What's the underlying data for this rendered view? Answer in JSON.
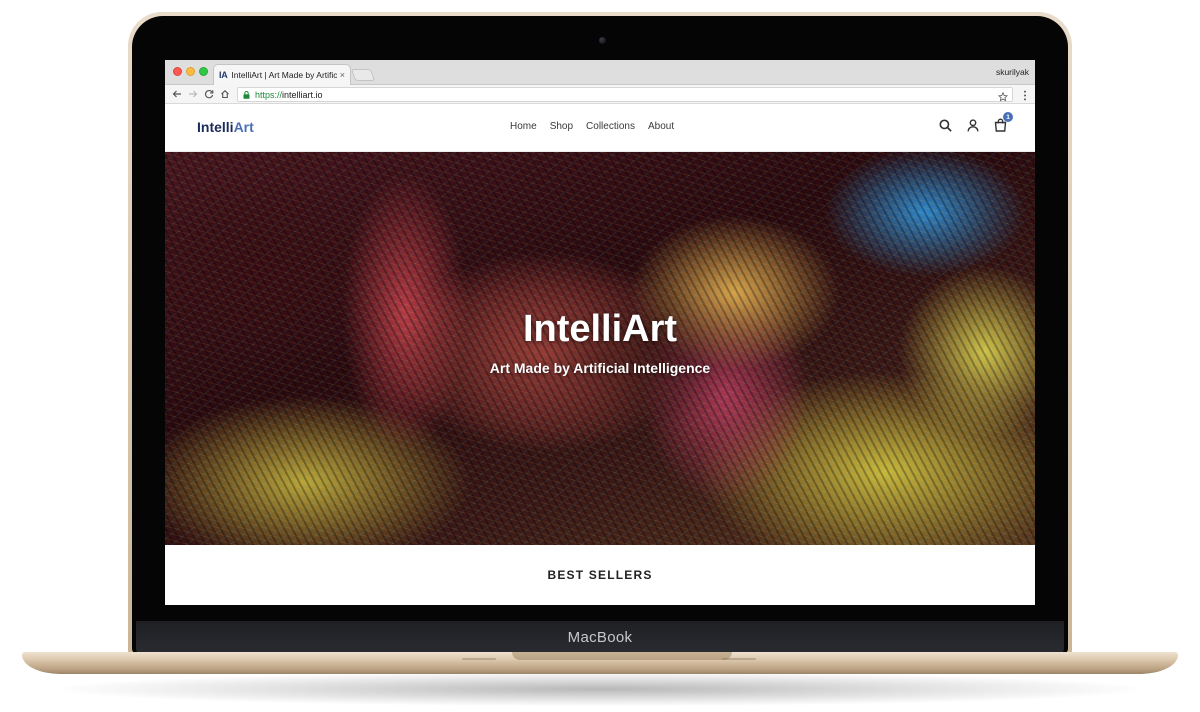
{
  "device": {
    "brand_label": "MacBook"
  },
  "browser": {
    "tab": {
      "favicon_text": "IA",
      "title": "IntelliArt | Art Made by Artificial Intelligence",
      "close_label": "×"
    },
    "profile_name": "skurilyak",
    "address": {
      "protocol": "https://",
      "host": "intelliart.io"
    }
  },
  "site": {
    "logo": {
      "part1": "Intelli",
      "part2": "Art"
    },
    "nav": [
      {
        "label": "Home"
      },
      {
        "label": "Shop"
      },
      {
        "label": "Collections"
      },
      {
        "label": "About"
      }
    ],
    "header_icons": [
      "search-icon",
      "account-icon",
      "cart-icon"
    ],
    "cart_count": "1",
    "hero": {
      "title": "IntelliArt",
      "subtitle": "Art Made by Artificial Intelligence"
    },
    "best_sellers_heading": "BEST SELLERS"
  },
  "colors": {
    "brand_dark": "#1b2b59",
    "brand_light": "#4a6fb6",
    "secure_url_green": "#1e8a39",
    "laptop_gold": "#d7c4ab"
  }
}
